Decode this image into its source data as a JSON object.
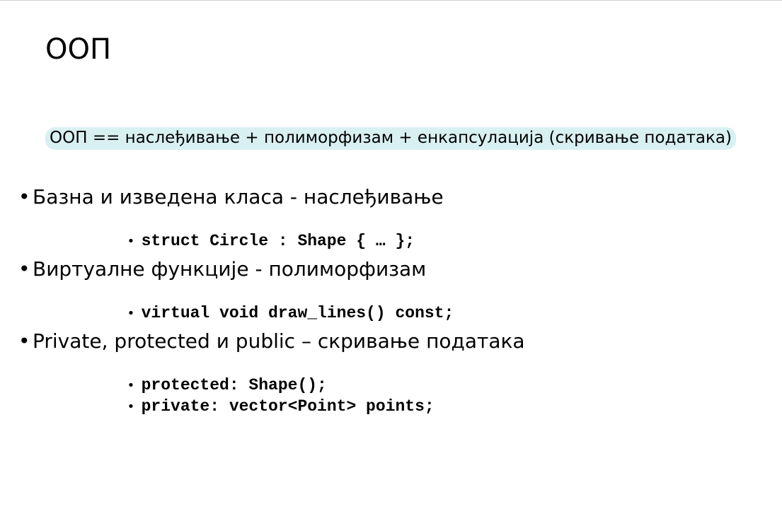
{
  "slide": {
    "title": "ООП",
    "summary": "ООП == наслеђивање + полиморфизам + енкапсулација (скривање података)",
    "bullet_glyph": "•",
    "bullets": [
      {
        "text": "Базна и изведена класа - наслеђивање",
        "code": [
          "struct Circle : Shape { … };"
        ]
      },
      {
        "text": "Виртуалне функције - полиморфизам",
        "code": [
          "virtual void draw_lines() const;"
        ]
      },
      {
        "text": "Private, protected и public – скривање података",
        "code": [
          "protected: Shape();",
          "private: vector<Point> points;"
        ]
      }
    ]
  },
  "colors": {
    "highlight_background": "#d9f0f2",
    "text": "#000000"
  }
}
